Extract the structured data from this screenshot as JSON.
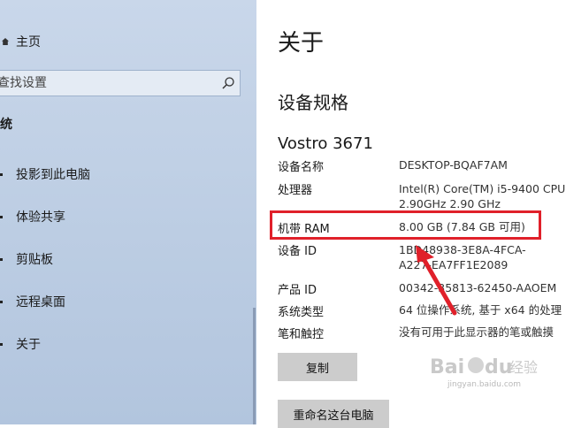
{
  "sidebar": {
    "home_label": "主页",
    "search_placeholder": "查找设置",
    "section_heading": "统",
    "items": [
      {
        "label": "投影到此电脑"
      },
      {
        "label": "体验共享"
      },
      {
        "label": "剪贴板"
      },
      {
        "label": "远程桌面"
      },
      {
        "label": "关于"
      }
    ]
  },
  "main": {
    "title": "关于",
    "section_title": "设备规格",
    "device_name": "Vostro 3671",
    "specs": [
      {
        "key": "设备名称",
        "value": "DESKTOP-BQAF7AM",
        "value2": ""
      },
      {
        "key": "处理器",
        "value": "Intel(R) Core(TM) i5-9400 CPU",
        "value2": "2.90GHz   2.90 GHz"
      },
      {
        "key": "机带 RAM",
        "value": "8.00 GB (7.84 GB 可用)",
        "value2": ""
      },
      {
        "key": "设备 ID",
        "value": "1BD48938-3E8A-4FCA-",
        "value2": "A227-EA7FF1E2089"
      },
      {
        "key": "产品 ID",
        "value": "00342-35813-62450-AAOEM",
        "value2": ""
      },
      {
        "key": "系统类型",
        "value": "64 位操作系统, 基于 x64 的处理",
        "value2": ""
      },
      {
        "key": "笔和触控",
        "value": "没有可用于此显示器的笔或触摸",
        "value2": ""
      }
    ],
    "copy_button": "复制",
    "rename_button": "重命名这台电脑"
  },
  "annotation": {
    "color": "#e0202a"
  },
  "watermark": {
    "brand": "Bai du 经验",
    "url": "jingyan.baidu.com"
  }
}
